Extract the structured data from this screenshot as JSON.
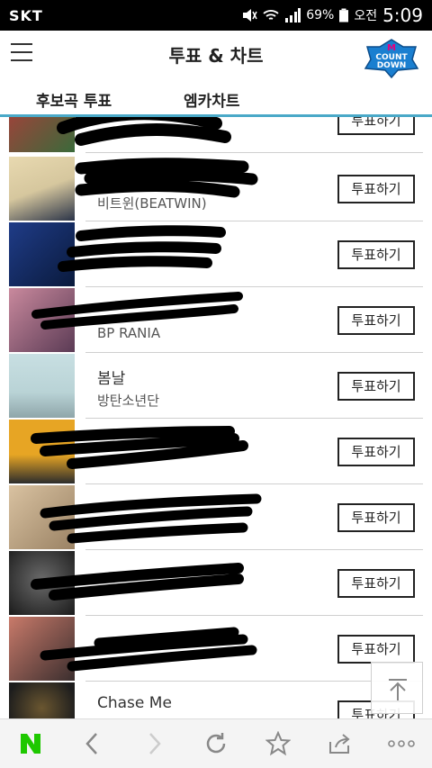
{
  "statusbar": {
    "carrier": "SKT",
    "battery": "69%",
    "ampm": "오전",
    "time": "5:09"
  },
  "header": {
    "title": "투표 & 차트",
    "logo_line1": "COUNT",
    "logo_line2": "DOWN"
  },
  "tabs": [
    {
      "label": "후보곡 투표"
    },
    {
      "label": "엠카차트"
    }
  ],
  "songs": [
    {
      "title": "",
      "artist": "",
      "vote": "투표하기",
      "thumb": [
        "#b33a3a",
        "#3a6a3a"
      ]
    },
    {
      "title": "",
      "artist": "비트윈(BEATWIN)",
      "vote": "투표하기",
      "thumb": [
        "#d6c79e",
        "#2b3448"
      ]
    },
    {
      "title": "",
      "artist": "",
      "vote": "투표하기",
      "thumb": [
        "#1f3c88",
        "#0a1a3c"
      ]
    },
    {
      "title": "",
      "artist": "BP RANIA",
      "vote": "투표하기",
      "thumb": [
        "#c9899d",
        "#5b3b55"
      ]
    },
    {
      "title": "봄날",
      "artist": "방탄소년단",
      "vote": "투표하기",
      "thumb": [
        "#b9d3d6",
        "#8fa6aa"
      ]
    },
    {
      "title": "",
      "artist": "",
      "vote": "투표하기",
      "thumb": [
        "#e7a524",
        "#2c2c2c"
      ]
    },
    {
      "title": "",
      "artist": "",
      "vote": "투표하기",
      "thumb": [
        "#d9c2a1",
        "#9a8264"
      ]
    },
    {
      "title": "",
      "artist": "",
      "vote": "투표하기",
      "thumb": [
        "#3b3b3b",
        "#1a1a1a"
      ]
    },
    {
      "title": "",
      "artist": "",
      "vote": "투표하기",
      "thumb": [
        "#c97a6a",
        "#3a2e2e"
      ]
    },
    {
      "title": "Chase Me",
      "artist": "",
      "vote": "투표하기",
      "thumb": [
        "#1d1d1d",
        "#3a3020"
      ]
    }
  ],
  "icons": {
    "wifi": "wifi-icon",
    "signal": "signal-icon",
    "battery": "battery-icon",
    "menu": "menu-icon",
    "scroll_top": "arrow-up-icon",
    "naver": "naver-n-icon",
    "back": "chevron-left-icon",
    "forward": "chevron-right-icon",
    "refresh": "refresh-icon",
    "bookmark": "star-icon",
    "share": "share-icon",
    "more": "more-icon"
  },
  "colors": {
    "accent": "#4aa9c8",
    "naver_green": "#1ec800"
  }
}
